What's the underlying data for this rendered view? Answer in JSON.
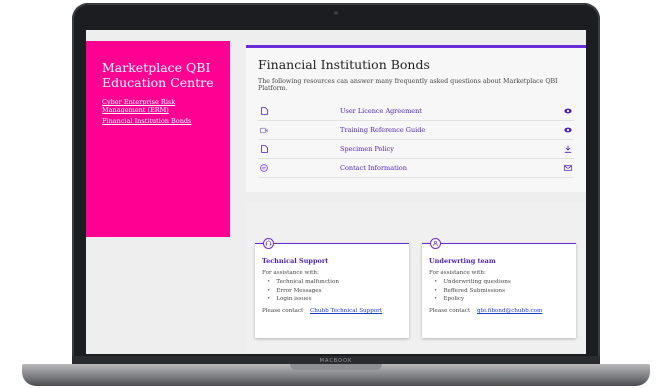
{
  "sidebar": {
    "title_line1": "Marketplace QBI",
    "title_line2": "Education Centre",
    "links": [
      "Cyber Enterprise Risk Management (ERM)",
      "Financial Institution Bonds"
    ]
  },
  "main": {
    "title": "Financial Institution Bonds",
    "description": "The following resources can answer many frequently asked questions about Marketplace QBI Platform.",
    "resources": [
      {
        "label": "User Licence Agreement",
        "left_icon": "document-icon",
        "right_icon": "eye-icon"
      },
      {
        "label": "Training Reference Guide",
        "left_icon": "video-icon",
        "right_icon": "eye-icon"
      },
      {
        "label": "Specimen Policy",
        "left_icon": "document-icon",
        "right_icon": "download-icon"
      },
      {
        "label": "Contact Information",
        "left_icon": "chat-icon",
        "right_icon": "mail-icon"
      }
    ]
  },
  "support": {
    "cards": [
      {
        "title": "Technical Support",
        "intro": "For assistance with:",
        "items": [
          "Technical malfunction",
          "Error Messages",
          "Login issues"
        ],
        "contact_prefix": "Please contact",
        "contact_link": "Chubb Technical Support"
      },
      {
        "title": "Underwrting team",
        "intro": "For assistance with:",
        "items": [
          "Underwriting questions",
          "Reffered Submissions",
          "Epolicy"
        ],
        "contact_prefix": "Please contact",
        "contact_link": "qbi.fibond@chubb.com"
      }
    ]
  },
  "laptop": {
    "brand": "MACBOOK"
  },
  "colors": {
    "accent_purple": "#6a2bd9",
    "brand_pink": "#ff0093",
    "link_blue": "#1a3bd1"
  }
}
